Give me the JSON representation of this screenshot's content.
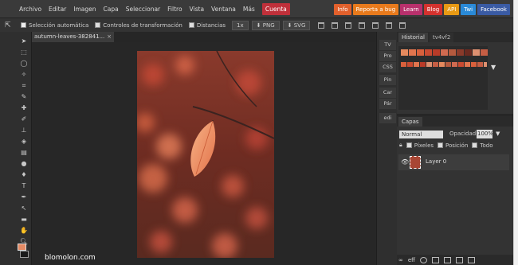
{
  "menu": {
    "items": [
      "Archivo",
      "Editar",
      "Imagen",
      "Capa",
      "Seleccionar",
      "Filtro",
      "Vista",
      "Ventana",
      "Más"
    ],
    "account": "Cuenta"
  },
  "external_links": [
    {
      "label": "Info",
      "color": "#e2602c"
    },
    {
      "label": "Reporta a bug",
      "color": "#e87a1c"
    },
    {
      "label": "Learn",
      "color": "#b8306c"
    },
    {
      "label": "Blog",
      "color": "#d4322e"
    },
    {
      "label": "API",
      "color": "#e89a14"
    },
    {
      "label": "Twi",
      "color": "#2a8ad8"
    },
    {
      "label": "Facebook",
      "color": "#3a5ba4"
    }
  ],
  "options": {
    "auto_select": "Selección automática",
    "transform_controls": "Controles de transformación",
    "distances": "Distancias",
    "zoom_btn": "1x",
    "png_btn": "PNG",
    "svg_btn": "SVG"
  },
  "document": {
    "tab_title": "autumn-leaves-382841...",
    "close": "×",
    "watermark": "blomolon.com"
  },
  "mini_panel": [
    "TV",
    "Pro",
    "CSS",
    "Pin",
    "Car",
    "Pár",
    "edi"
  ],
  "history": {
    "tab_label": "Historial",
    "tab2_label": "tv4vf2",
    "chips_row1": [
      "#e68a5e",
      "#e2754e",
      "#d9603c",
      "#c94a31",
      "#ba3b28",
      "#d06a50",
      "#b65a3e",
      "#8a3a2a",
      "#6b2a20",
      "#de9070",
      "#c65e44"
    ],
    "chips_row2_count": 14,
    "arrow": "▼"
  },
  "layers": {
    "tab_label": "Capas",
    "blend_mode": "Normal",
    "opacity_label": "Opacidad:",
    "opacity_value": "100%",
    "lock_pixels": "Píxeles",
    "lock_position": "Posición",
    "lock_all": "Todo",
    "layer_name": "Layer 0"
  },
  "colors": {
    "foreground": "#e48a64",
    "background": "#1a1a1a"
  }
}
